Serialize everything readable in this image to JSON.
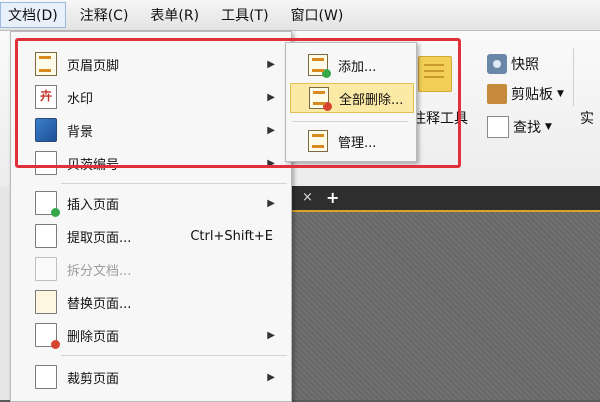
{
  "menubar": {
    "items": [
      {
        "label": "文档(D)",
        "active": true
      },
      {
        "label": "注释(C)"
      },
      {
        "label": "表单(R)"
      },
      {
        "label": "工具(T)"
      },
      {
        "label": "窗口(W)"
      }
    ]
  },
  "ribbon": {
    "snapshot": "快照",
    "clipboard": "剪贴板",
    "find": "查找",
    "partial_right": "实",
    "partial_notes": "注释工具"
  },
  "menu": {
    "items": [
      {
        "label": "页眉页脚",
        "icon": "header-footer-icon",
        "submenu": true
      },
      {
        "label": "水印",
        "icon": "watermark-icon",
        "submenu": true
      },
      {
        "label": "背景",
        "icon": "background-icon",
        "submenu": true
      },
      {
        "label": "贝茨编号",
        "icon": "bates-number-icon",
        "submenu": true
      },
      {
        "label": "插入页面",
        "icon": "insert-page-icon",
        "submenu": true
      },
      {
        "label": "提取页面...",
        "icon": "extract-page-icon",
        "shortcut": "Ctrl+Shift+E"
      },
      {
        "label": "拆分文档...",
        "icon": "split-document-icon",
        "disabled": true
      },
      {
        "label": "替换页面...",
        "icon": "replace-page-icon"
      },
      {
        "label": "删除页面",
        "icon": "delete-page-icon",
        "submenu": true
      },
      {
        "label": "裁剪页面",
        "icon": "crop-page-icon",
        "submenu": true
      }
    ],
    "watermark_glyph": "卉"
  },
  "submenu": {
    "items": [
      {
        "label": "添加...",
        "icon": "add-icon"
      },
      {
        "label": "全部删除...",
        "icon": "delete-all-icon",
        "highlighted": true
      },
      {
        "label": "管理...",
        "icon": "manage-icon"
      }
    ]
  },
  "tabs": {
    "close_glyph": "×",
    "new_tab_glyph": "+"
  },
  "colors": {
    "highlight_frame": "#e0303a",
    "submenu_hover": "#fbe9a6",
    "tab_accent": "#d9a326"
  }
}
